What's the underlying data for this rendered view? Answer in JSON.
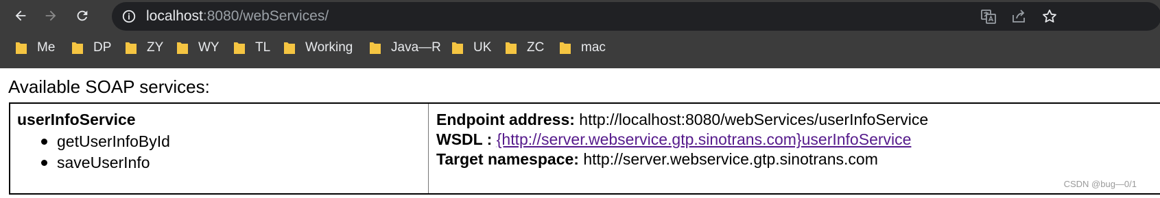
{
  "browser": {
    "url_host": "localhost",
    "url_rest": ":8080/webServices/",
    "bookmarks": [
      "Me",
      "DP",
      "ZY",
      "WY",
      "TL",
      "Working",
      "Java—R",
      "UK",
      "ZC",
      "mac"
    ]
  },
  "page": {
    "heading": "Available SOAP services:",
    "service": {
      "name": "userInfoService",
      "operations": [
        "getUserInfoById",
        "saveUserInfo"
      ],
      "endpoint_label": "Endpoint address:",
      "endpoint_value": "http://localhost:8080/webServices/userInfoService",
      "wsdl_label": "WSDL :",
      "wsdl_link": "{http://server.webservice.gtp.sinotrans.com}userInfoService",
      "namespace_label": "Target namespace:",
      "namespace_value": "http://server.webservice.gtp.sinotrans.com"
    },
    "watermark": "CSDN @bug—0/1"
  },
  "colors": {
    "chrome_bg": "#3c3c3c",
    "omnibox_bg": "#202124",
    "folder": "#f5c542",
    "link": "#551a8b"
  }
}
